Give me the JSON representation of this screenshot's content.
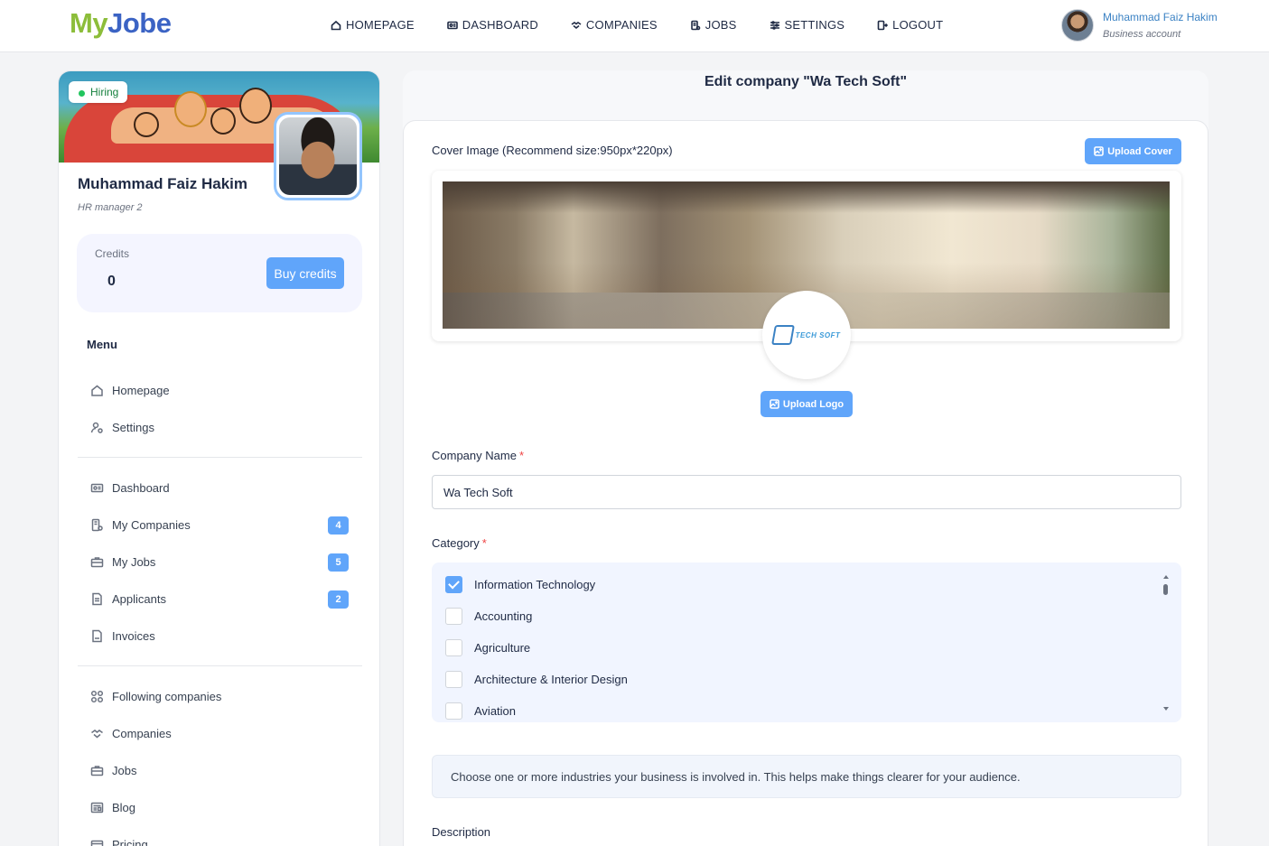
{
  "app": {
    "logo_part1": "My",
    "logo_part2": "Jobe"
  },
  "nav": [
    {
      "label": "HOMEPAGE",
      "icon": "home-icon"
    },
    {
      "label": "DASHBOARD",
      "icon": "dashboard-icon"
    },
    {
      "label": "COMPANIES",
      "icon": "handshake-icon"
    },
    {
      "label": "JOBS",
      "icon": "jobs-icon"
    },
    {
      "label": "SETTINGS",
      "icon": "sliders-icon"
    },
    {
      "label": "LOGOUT",
      "icon": "logout-icon"
    }
  ],
  "user": {
    "name": "Muhammad Faiz Hakim",
    "account_type": "Business account"
  },
  "profile": {
    "status_badge": "Hiring",
    "name": "Muhammad Faiz Hakim",
    "role": "HR manager 2",
    "credits_label": "Credits",
    "credits_value": "0",
    "buy_credits_label": "Buy credits"
  },
  "menu": {
    "title": "Menu",
    "group1": [
      {
        "label": "Homepage",
        "icon": "home-icon"
      },
      {
        "label": "Settings",
        "icon": "user-settings-icon"
      }
    ],
    "group2": [
      {
        "label": "Dashboard",
        "icon": "dashboard-icon"
      },
      {
        "label": "My Companies",
        "icon": "building-icon",
        "badge": "4"
      },
      {
        "label": "My Jobs",
        "icon": "briefcase-icon",
        "badge": "5"
      },
      {
        "label": "Applicants",
        "icon": "document-icon",
        "badge": "2"
      },
      {
        "label": "Invoices",
        "icon": "pdf-icon"
      }
    ],
    "group3": [
      {
        "label": "Following companies",
        "icon": "grid-icon"
      },
      {
        "label": "Companies",
        "icon": "handshake-icon"
      },
      {
        "label": "Jobs",
        "icon": "briefcase-icon"
      },
      {
        "label": "Blog",
        "icon": "newspaper-icon"
      },
      {
        "label": "Pricing",
        "icon": "pricing-icon"
      }
    ]
  },
  "editor": {
    "page_title": "Edit company \"Wa Tech Soft\"",
    "cover_label": "Cover Image (Recommend size:950px*220px)",
    "upload_cover_label": "Upload Cover",
    "company_logo_text": "TECH SOFT",
    "upload_logo_label": "Upload Logo",
    "company_name_label": "Company Name",
    "company_name_value": "Wa Tech Soft",
    "required_mark": "*",
    "category_label": "Category",
    "categories": [
      {
        "label": "Information Technology",
        "checked": true
      },
      {
        "label": "Accounting",
        "checked": false
      },
      {
        "label": "Agriculture",
        "checked": false
      },
      {
        "label": "Architecture & Interior Design",
        "checked": false
      },
      {
        "label": "Aviation",
        "checked": false
      }
    ],
    "category_hint": "Choose one or more industries your business is involved in. This helps make things clearer for your audience.",
    "description_label": "Description"
  },
  "colors": {
    "accent": "#60a5fa",
    "brand_green": "#8cbd3a",
    "brand_blue": "#3b63c4",
    "required": "#ef4444",
    "hiring_green": "#22c55e"
  }
}
